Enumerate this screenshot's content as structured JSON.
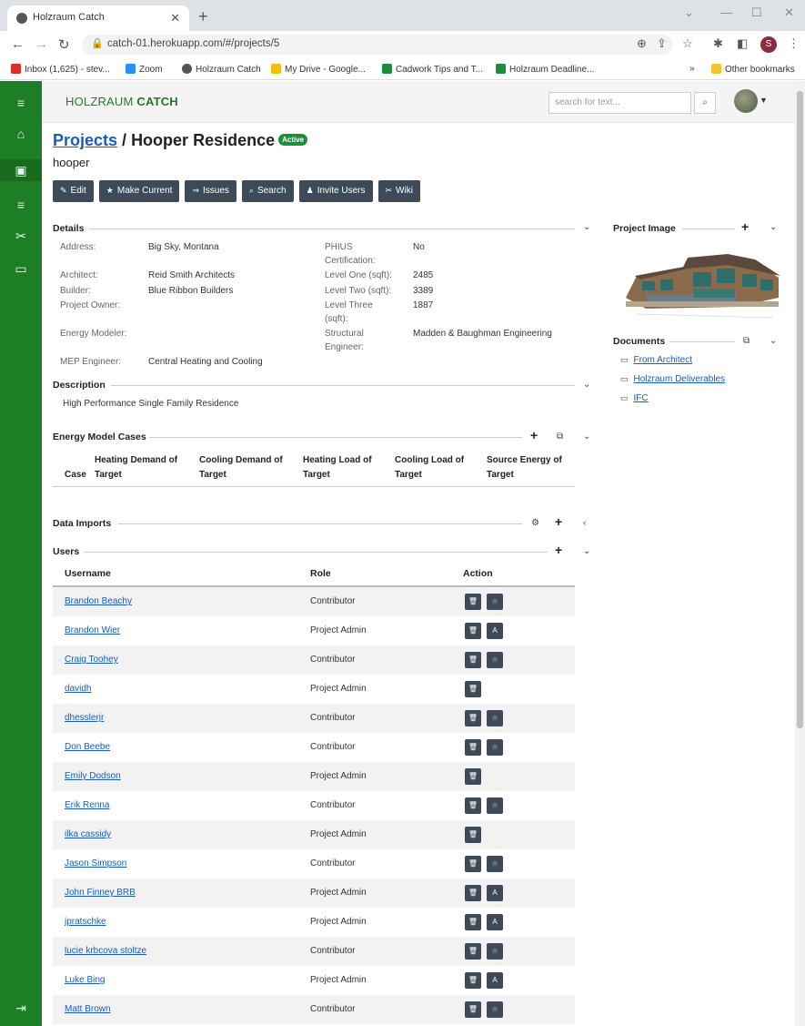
{
  "browser": {
    "tab_title": "Holzraum Catch",
    "url": "catch-01.herokuapp.com/#/projects/5",
    "profile_initial": "S",
    "bookmarks": [
      {
        "label": "Inbox (1,625) - stev...",
        "color": "#d93025"
      },
      {
        "label": "Zoom",
        "color": "#2d8cff"
      },
      {
        "label": "Holzraum Catch",
        "color": "#555555"
      },
      {
        "label": "My Drive - Google...",
        "color": "#fbbc04"
      },
      {
        "label": "Cadwork Tips and T...",
        "color": "#1e8e3e"
      },
      {
        "label": "Holzraum Deadline...",
        "color": "#1e8e3e"
      }
    ],
    "bookmarks_overflow": "»",
    "other_bookmarks": "Other bookmarks"
  },
  "app": {
    "brand_plain": "HOLZRAUM ",
    "brand_bold": "CATCH",
    "search_placeholder": "search for text...",
    "accent": "#1e7e26"
  },
  "page": {
    "breadcrumb_link": "Projects",
    "breadcrumb_sep": " / ",
    "project_name": "Hooper Residence",
    "status_badge": "Active",
    "project_code": "hooper"
  },
  "toolbar": {
    "edit": "Edit",
    "make_current": "Make Current",
    "issues": "Issues",
    "search": "Search",
    "invite_users": "Invite Users",
    "wiki": "Wiki"
  },
  "details": {
    "title": "Details",
    "address_label": "Address:",
    "address_value": "Big Sky, Montana",
    "architect_label": "Architect:",
    "architect_value": "Reid Smith Architects",
    "builder_label": "Builder:",
    "builder_value": "Blue Ribbon Builders",
    "owner_label": "Project Owner:",
    "energy_label": "Energy Modeler:",
    "mep_label": "MEP Engineer:",
    "mep_value": "Central Heating and Cooling",
    "phius_label_1": "PHIUS",
    "phius_label_2": "Certification:",
    "phius_value": "No",
    "level1_label": "Level One (sqft):",
    "level1_value": "2485",
    "level2_label": "Level Two (sqft):",
    "level2_value": "3389",
    "level3_label_1": "Level Three",
    "level3_label_2": "(sqft):",
    "level3_value": "1887",
    "struct_label_1": "Structural",
    "struct_label_2": "Engineer:",
    "struct_value": "Madden & Baughman Engineering"
  },
  "description": {
    "title": "Description",
    "text": "High Performance Single Family Residence"
  },
  "energy_cases": {
    "title": "Energy Model Cases",
    "col_case": "Case",
    "col_heating_demand_1": "Heating Demand of",
    "col_target": "Target",
    "col_cooling_demand_1": "Cooling Demand of",
    "col_heating_load_1": "Heating Load of",
    "col_cooling_load_1": "Cooling Load of",
    "col_source_energy_1": "Source Energy of"
  },
  "data_imports": {
    "title": "Data Imports"
  },
  "users": {
    "title": "Users",
    "col_username": "Username",
    "col_role": "Role",
    "col_action": "Action",
    "rows": [
      {
        "name": "Brandon Beachy",
        "role": "Contributor",
        "second": "☆"
      },
      {
        "name": "Brandon Wier",
        "role": "Project Admin",
        "second": "A"
      },
      {
        "name": "Craig Toohey",
        "role": "Contributor",
        "second": "☆"
      },
      {
        "name": "davidh",
        "role": "Project Admin",
        "second": ""
      },
      {
        "name": "dhesslerjr",
        "role": "Contributor",
        "second": "☆"
      },
      {
        "name": "Don Beebe",
        "role": "Contributor",
        "second": "☆"
      },
      {
        "name": "Emily Dodson",
        "role": "Project Admin",
        "second": ""
      },
      {
        "name": "Erik Renna",
        "role": "Contributor",
        "second": "☆"
      },
      {
        "name": "ilka cassidy",
        "role": "Project Admin",
        "second": ""
      },
      {
        "name": "Jason Simpson",
        "role": "Contributor",
        "second": "☆"
      },
      {
        "name": "John Finney BRB",
        "role": "Project Admin",
        "second": "A"
      },
      {
        "name": "jpratschke",
        "role": "Project Admin",
        "second": "A"
      },
      {
        "name": "lucie krbcova stoltze",
        "role": "Contributor",
        "second": "☆"
      },
      {
        "name": "Luke Bing",
        "role": "Project Admin",
        "second": "A"
      },
      {
        "name": "Matt Brown",
        "role": "Contributor",
        "second": "☆"
      }
    ]
  },
  "right_panel": {
    "image_title": "Project Image",
    "documents_title": "Documents",
    "documents": [
      "From Architect",
      "Holzraum Deliverables",
      "IFC"
    ]
  }
}
